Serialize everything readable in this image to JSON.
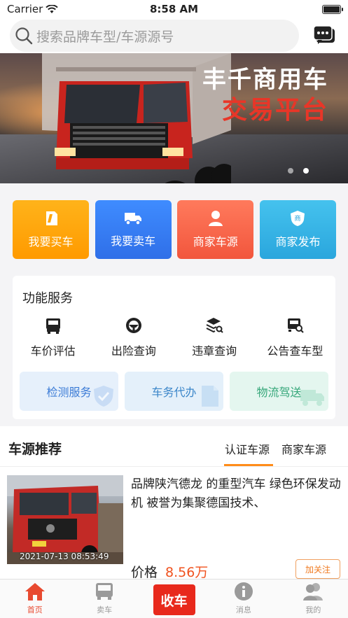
{
  "status_bar": {
    "carrier": "Carrier",
    "time": "8:58 AM"
  },
  "search": {
    "placeholder": "搜索品牌车型/车源源号"
  },
  "banner": {
    "title_line1": "丰千商用车",
    "title_line2": "交易平台"
  },
  "quick_actions": [
    {
      "label": "我要买车",
      "icon": "tag-icon"
    },
    {
      "label": "我要卖车",
      "icon": "truck-icon"
    },
    {
      "label": "商家车源",
      "icon": "person-icon"
    },
    {
      "label": "商家发布",
      "icon": "shield-icon"
    }
  ],
  "services": {
    "title": "功能服务",
    "items": [
      {
        "label": "车价评估",
        "icon": "truck-front-icon"
      },
      {
        "label": "出险查询",
        "icon": "steering-wheel-icon"
      },
      {
        "label": "违章查询",
        "icon": "stack-search-icon"
      },
      {
        "label": "公告查车型",
        "icon": "truck-search-icon"
      }
    ],
    "tiles": [
      {
        "label": "检测服务",
        "icon": "shield-check-icon"
      },
      {
        "label": "车务代办",
        "icon": "document-icon"
      },
      {
        "label": "物流驾送",
        "icon": "truck-icon"
      }
    ]
  },
  "recommend": {
    "title": "车源推荐",
    "tabs": [
      "认证车源",
      "商家车源"
    ],
    "active_tab": "认证车源"
  },
  "listing": {
    "description": "品牌陕汽德龙 的重型汽车 绿色环保发动机 被誉为集聚德国技术、",
    "date": "2021-07-13 08:53:49",
    "price_label": "价格",
    "price_value": "8.56万",
    "follow_label": "加关注"
  },
  "tab_bar": {
    "items": [
      {
        "label": "首页",
        "icon": "home-icon"
      },
      {
        "label": "卖车",
        "icon": "bus-icon"
      },
      {
        "label": "收车",
        "icon": ""
      },
      {
        "label": "消息",
        "icon": "info-icon"
      },
      {
        "label": "我的",
        "icon": "users-icon"
      }
    ],
    "active": "首页"
  },
  "colors": {
    "accent": "#e8291c",
    "price": "#f0521e",
    "tab_underline": "#ff8c1a"
  }
}
